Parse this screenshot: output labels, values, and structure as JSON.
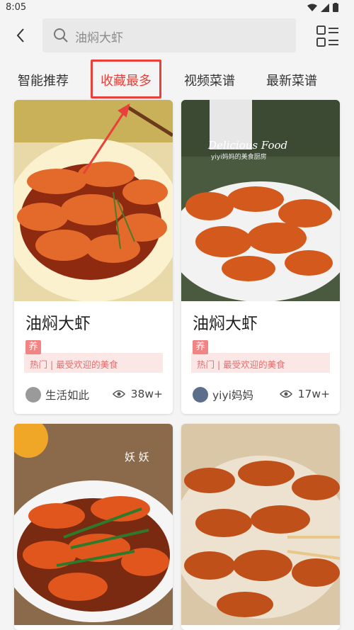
{
  "status": {
    "time": "8:05"
  },
  "search": {
    "text": "油焖大虾"
  },
  "tabs": [
    "智能推荐",
    "收藏最多",
    "视频菜谱",
    "最新菜谱"
  ],
  "cards": [
    {
      "title": "油焖大虾",
      "tag": "养",
      "desc": "热门 | 最受欢迎的美食",
      "author": "生活如此",
      "views": "38w+"
    },
    {
      "title": "油焖大虾",
      "tag": "养",
      "desc": "热门 | 最受欢迎的美食",
      "author": "yiyi妈妈",
      "views": "17w+",
      "watermark": "Delicious Food",
      "watermark_sub": "yiyi妈妈的美食厨房"
    },
    {
      "watermark": "妖  妖"
    }
  ],
  "colors": {
    "accent": "#e8413a",
    "tag": "#f18585",
    "strip": "#fbe7e6"
  }
}
